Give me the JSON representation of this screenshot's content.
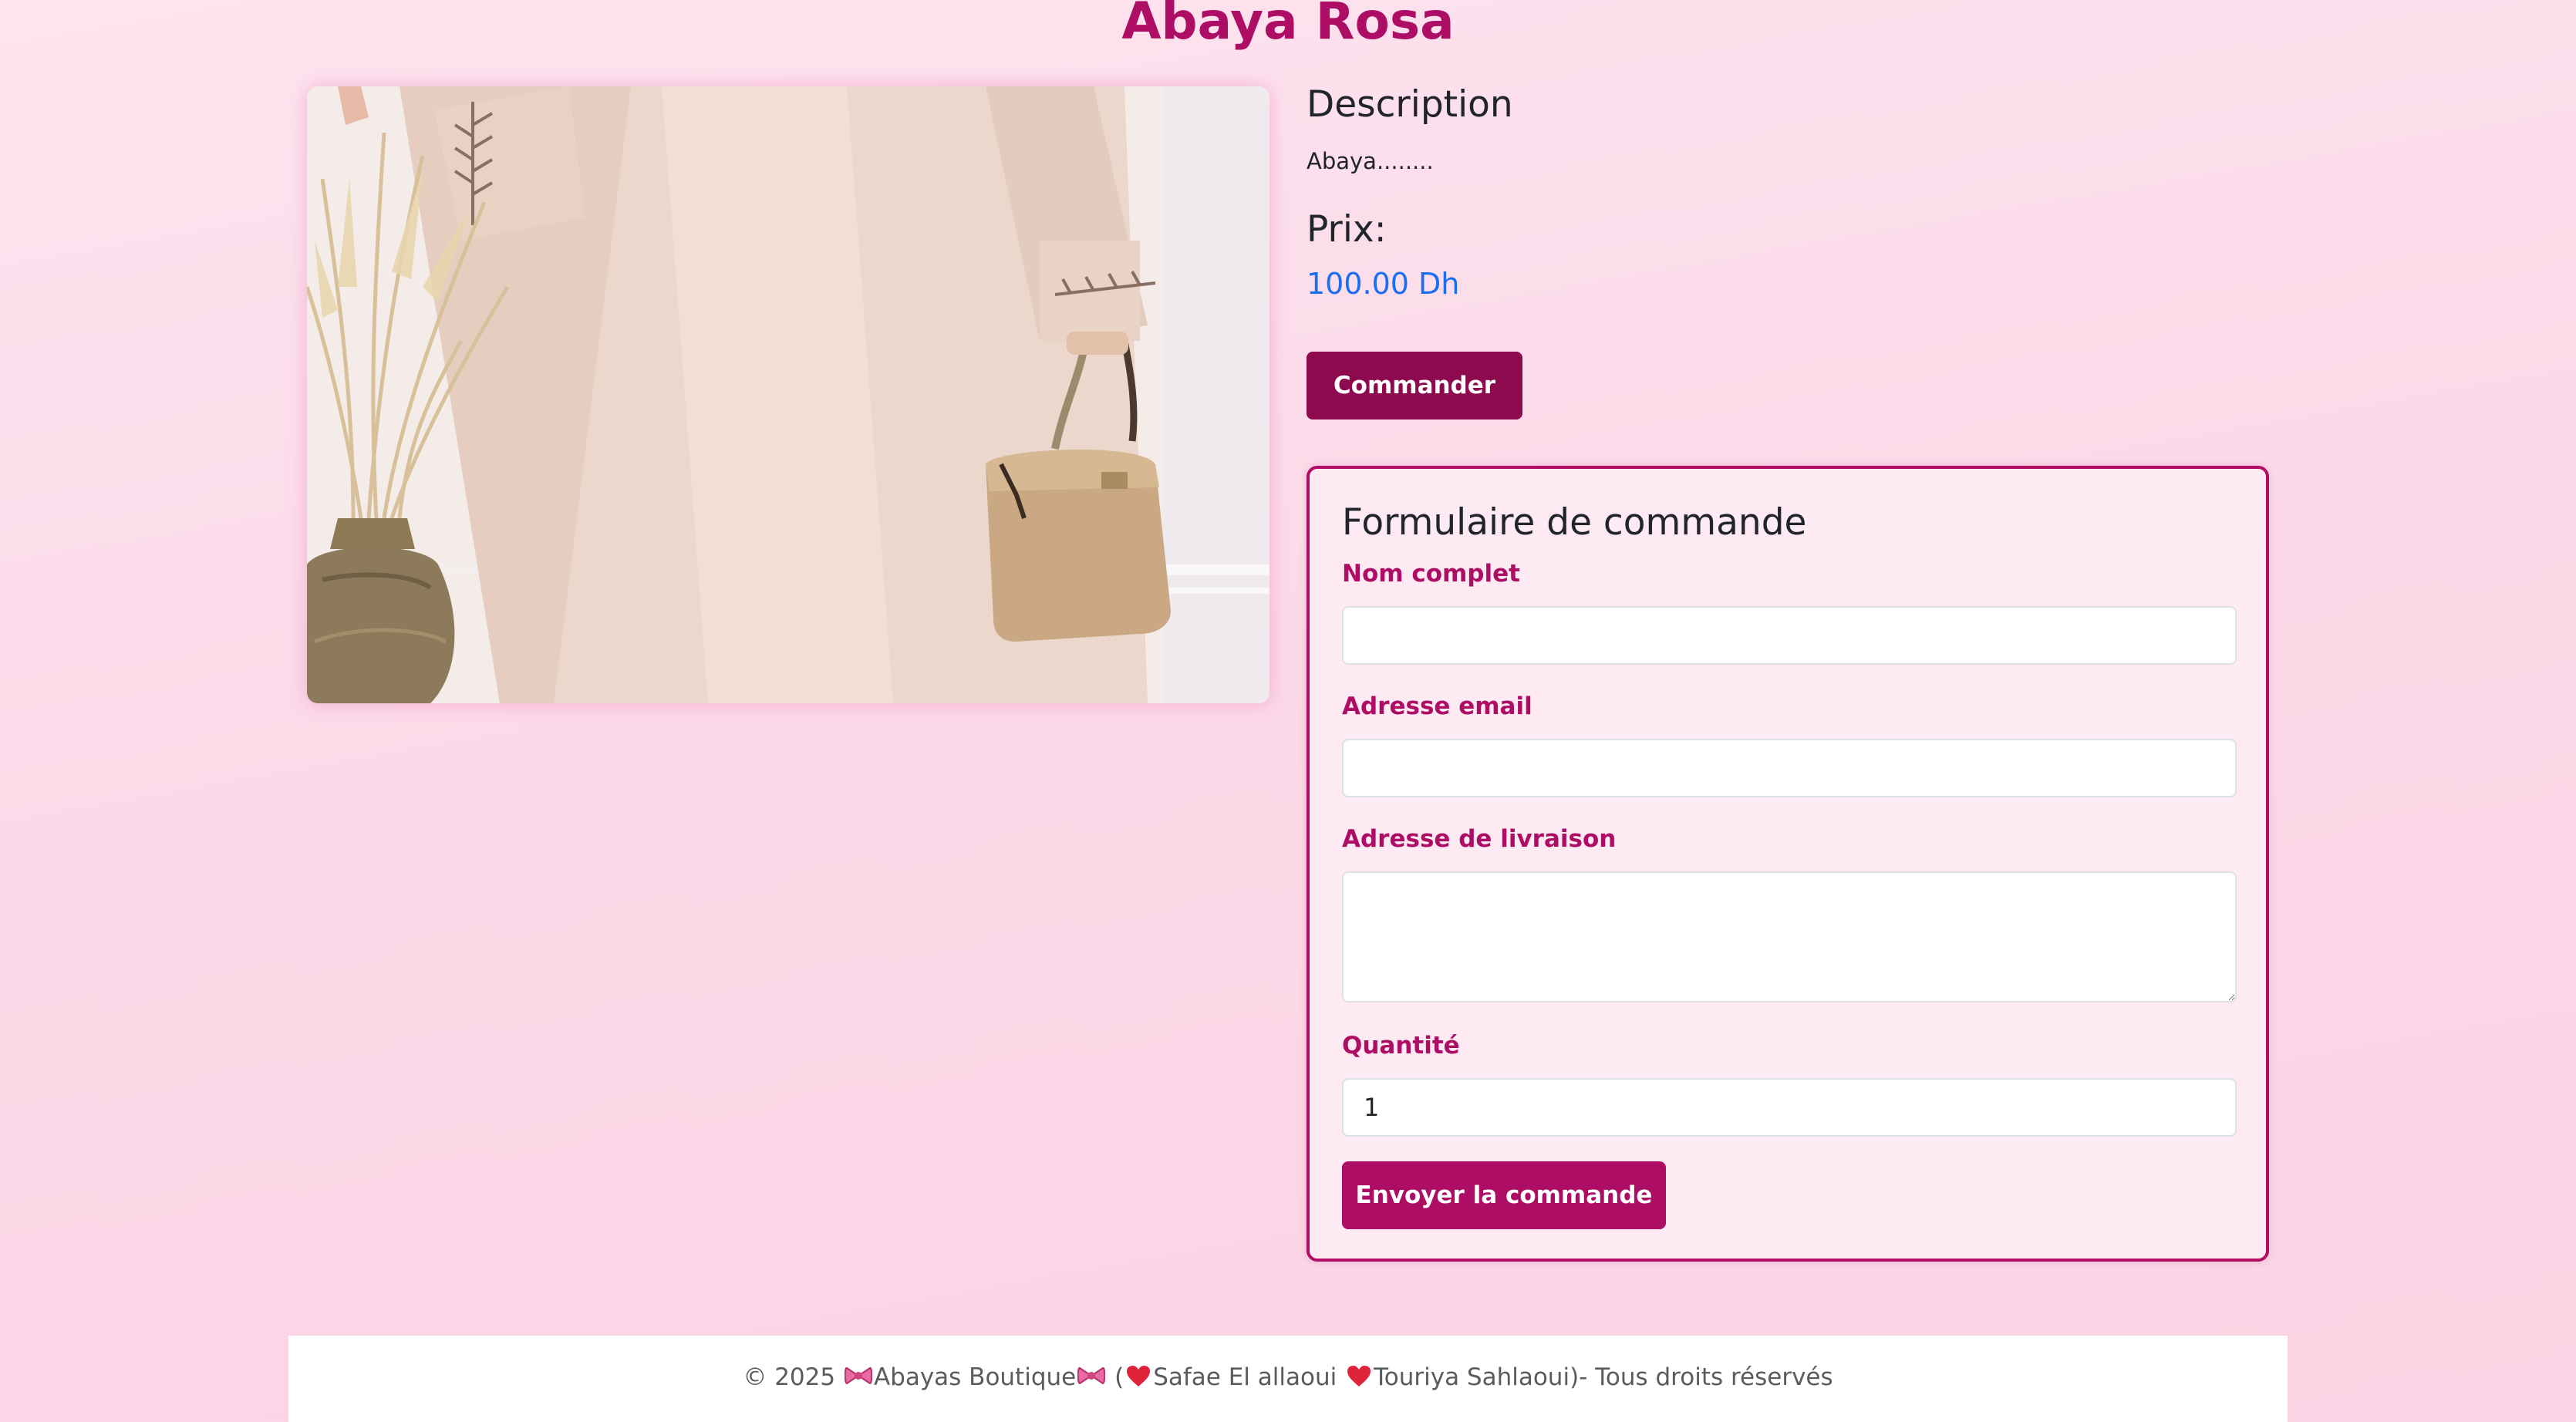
{
  "page": {
    "title": "Abaya Rosa"
  },
  "product": {
    "image_alt": "Abaya Rosa",
    "description_heading": "Description",
    "description_text": "Abaya........",
    "price_heading": "Prix:",
    "price_value": "100.00 Dh",
    "order_button": "Commander"
  },
  "order_form": {
    "title": "Formulaire de commande",
    "name_label": "Nom complet",
    "name_value": "",
    "email_label": "Adresse email",
    "email_value": "",
    "address_label": "Adresse de livraison",
    "address_value": "",
    "quantity_label": "Quantité",
    "quantity_value": "1",
    "submit_button": "Envoyer la commande"
  },
  "footer": {
    "copyright": "© 2025",
    "brand": "Abayas Boutique",
    "open_paren": "(",
    "author_1": "Safae El allaoui",
    "author_2": "Touriya Sahlaoui)- Tous droits réservés"
  },
  "icons": {
    "bow": "ribbon-bow-icon",
    "heart": "heart-icon"
  },
  "colors": {
    "accent": "#ad0d64",
    "button_dark": "#8e0a4f",
    "price": "#1a6ef2",
    "background": "#fcd9e8"
  }
}
